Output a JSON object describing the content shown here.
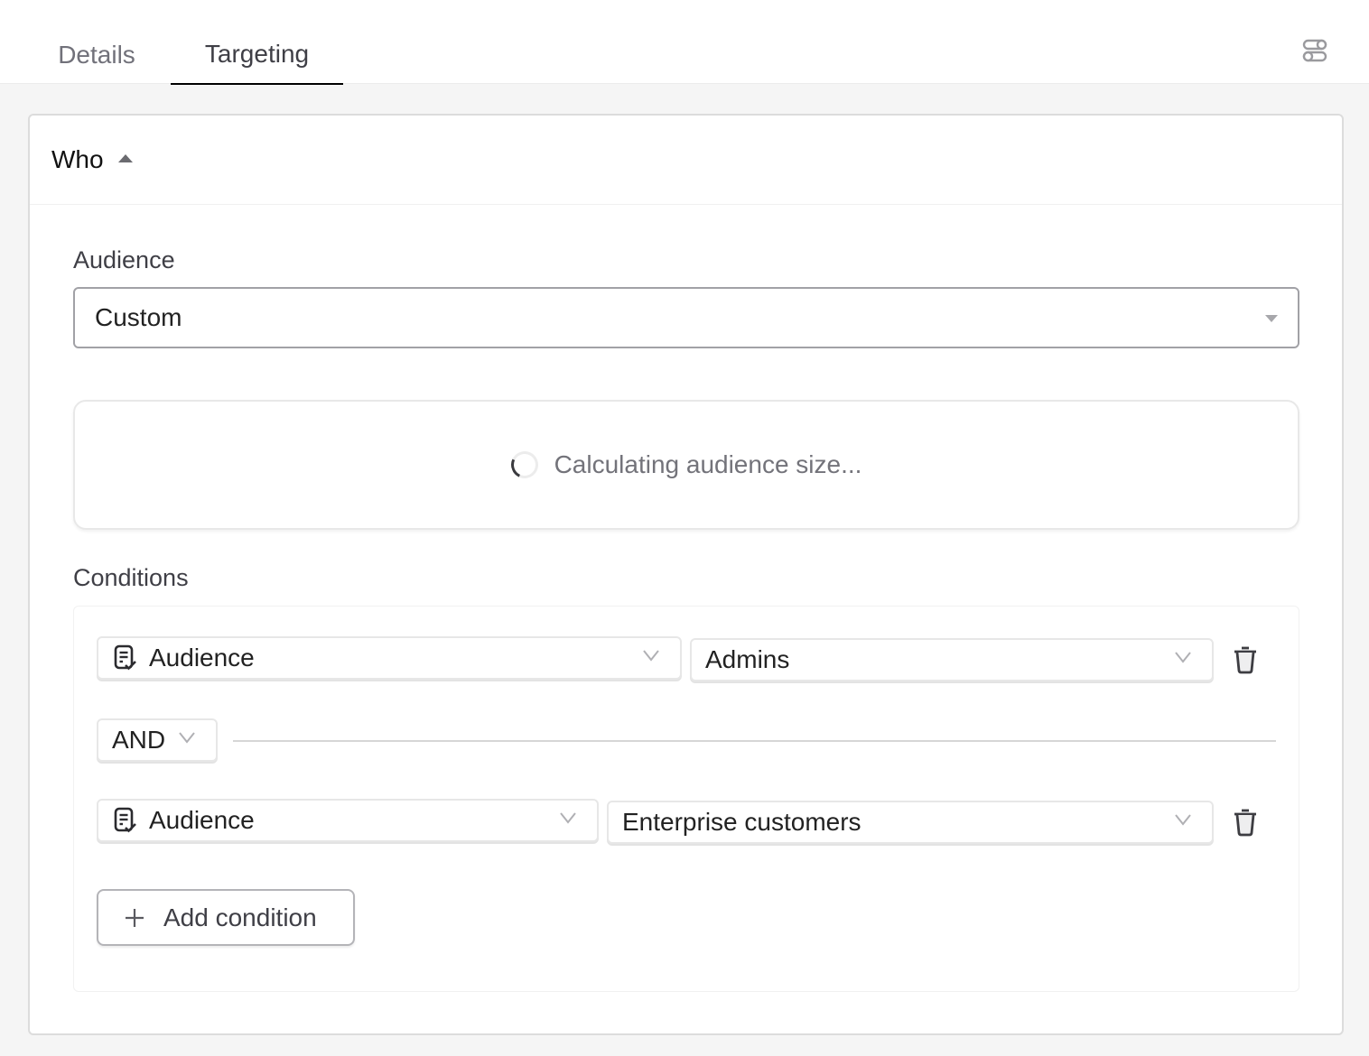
{
  "tabs": [
    {
      "label": "Details",
      "active": false
    },
    {
      "label": "Targeting",
      "active": true
    }
  ],
  "settings_icon": "toggles-icon",
  "section": {
    "title": "Who",
    "expanded": true
  },
  "audience": {
    "label": "Audience",
    "selected": "Custom"
  },
  "audience_size": {
    "status_text": "Calculating audience size...",
    "loading": true
  },
  "conditions": {
    "label": "Conditions",
    "rows": [
      {
        "field": "Audience",
        "field_icon": "document-check-icon",
        "value": "Admins"
      },
      {
        "field": "Audience",
        "field_icon": "document-check-icon",
        "value": "Enterprise customers"
      }
    ],
    "operator": "AND",
    "add_label": "Add condition"
  },
  "colors": {
    "active_tab_underline": "#000000",
    "page_background": "#f5f5f5",
    "muted_text": "#71717a"
  }
}
